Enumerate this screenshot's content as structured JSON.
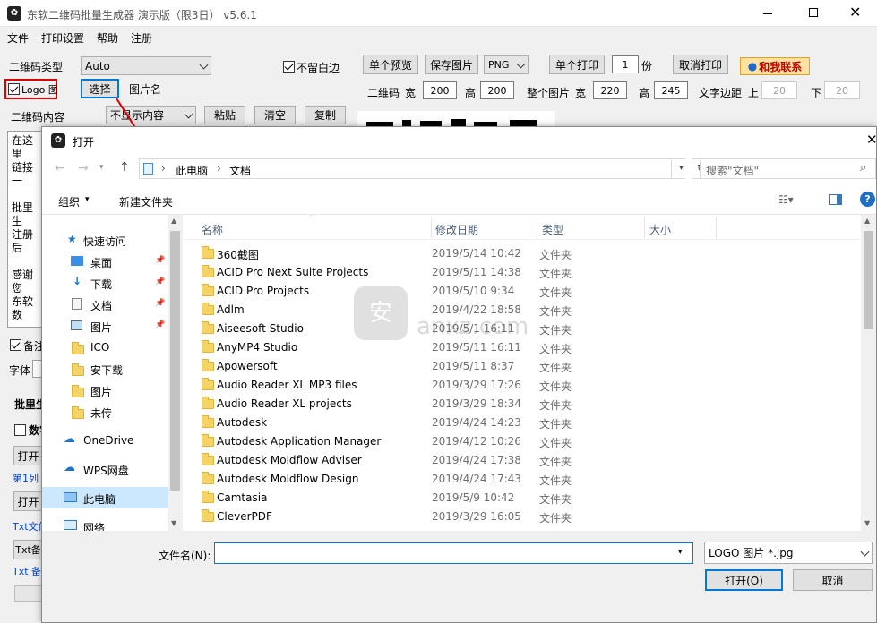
{
  "app": {
    "title": "东软二维码批量生成器 演示版（限3日） v5.6.1"
  },
  "menu": [
    "文件",
    "打印设置",
    "帮助",
    "注册"
  ],
  "main": {
    "qr_type_label": "二维码类型",
    "qr_type_value": "Auto",
    "no_margin_label": "不留白边",
    "logo_label": "Logo 图",
    "select_button": "选择",
    "image_name_label": "图片名",
    "content_label": "二维码内容",
    "content_option": "不显示内容",
    "paste_button": "粘贴",
    "clear_button": "清空",
    "copy_button": "复制",
    "preview_button": "单个预览",
    "save_image_button": "保存图片",
    "format_value": "PNG",
    "print_button": "单个打印",
    "copies_value": "1",
    "copies_unit": "份",
    "cancel_print_button": "取消打印",
    "contact_button": "和我联系",
    "qr_label": "二维码",
    "width_label": "宽",
    "width_value": "200",
    "height_label": "高",
    "height_value": "200",
    "whole_label": "整个图片",
    "whole_width_label": "宽",
    "whole_width_value": "220",
    "whole_height_label": "高",
    "whole_height_value": "245",
    "text_margin_label": "文字边距",
    "top_label": "上",
    "top_value": "20",
    "bottom_label": "下",
    "bottom_value": "20",
    "textarea_lines": [
      "在这里",
      "链接一",
      "",
      "批里生",
      "注册后",
      "",
      "感谢您",
      "东软数"
    ],
    "backup_label": "备注",
    "font_label": "字体",
    "batch_label": "批里生",
    "number_label": "数字",
    "open_button_1": "打开",
    "col1_label": "第1列",
    "open_button_2": "打开",
    "txt_label_1": "Txt文件",
    "txt_backup_button": "Txt备",
    "txt_label_2": "Txt 备"
  },
  "dialog": {
    "title": "打开",
    "breadcrumb": [
      "此电脑",
      "文档"
    ],
    "search_placeholder": "搜索\"文档\"",
    "organize_label": "组织",
    "new_folder_label": "新建文件夹",
    "columns": {
      "name": "名称",
      "date": "修改日期",
      "type": "类型",
      "size": "大小"
    },
    "nav": [
      {
        "label": "快速访问",
        "icon": "star-icon"
      },
      {
        "label": "桌面",
        "icon": "desktop-icon",
        "pinned": true
      },
      {
        "label": "下载",
        "icon": "download-icon",
        "pinned": true
      },
      {
        "label": "文档",
        "icon": "document-icon",
        "pinned": true
      },
      {
        "label": "图片",
        "icon": "picture-icon",
        "pinned": true
      },
      {
        "label": "ICO",
        "icon": "folder-icon"
      },
      {
        "label": "安下载",
        "icon": "folder-icon"
      },
      {
        "label": "图片",
        "icon": "folder-icon"
      },
      {
        "label": "未传",
        "icon": "folder-icon"
      },
      {
        "label": "OneDrive",
        "icon": "cloud-icon"
      },
      {
        "label": "WPS网盘",
        "icon": "cloud-icon"
      },
      {
        "label": "此电脑",
        "icon": "computer-icon"
      },
      {
        "label": "网络",
        "icon": "network-icon"
      }
    ],
    "files": [
      {
        "name": "360截图",
        "date": "2019/5/14 10:42",
        "type": "文件夹"
      },
      {
        "name": "ACID Pro Next Suite Projects",
        "date": "2019/5/11 14:38",
        "type": "文件夹"
      },
      {
        "name": "ACID Pro Projects",
        "date": "2019/5/10 9:34",
        "type": "文件夹"
      },
      {
        "name": "Adlm",
        "date": "2019/4/22 18:58",
        "type": "文件夹"
      },
      {
        "name": "Aiseesoft Studio",
        "date": "2019/5/1 16:11",
        "type": "文件夹"
      },
      {
        "name": "AnyMP4 Studio",
        "date": "2019/5/11 16:11",
        "type": "文件夹"
      },
      {
        "name": "Apowersoft",
        "date": "2019/5/11 8:37",
        "type": "文件夹"
      },
      {
        "name": "Audio Reader XL MP3 files",
        "date": "2019/3/29 17:26",
        "type": "文件夹"
      },
      {
        "name": "Audio Reader XL projects",
        "date": "2019/3/29 18:34",
        "type": "文件夹"
      },
      {
        "name": "Autodesk",
        "date": "2019/4/24 14:23",
        "type": "文件夹"
      },
      {
        "name": "Autodesk Application Manager",
        "date": "2019/4/12 10:26",
        "type": "文件夹"
      },
      {
        "name": "Autodesk Moldflow Adviser",
        "date": "2019/4/24 17:38",
        "type": "文件夹"
      },
      {
        "name": "Autodesk Moldflow Design",
        "date": "2019/4/24 17:43",
        "type": "文件夹"
      },
      {
        "name": "Camtasia",
        "date": "2019/5/9 10:42",
        "type": "文件夹"
      },
      {
        "name": "CleverPDF",
        "date": "2019/3/29 16:05",
        "type": "文件夹"
      }
    ],
    "filename_label": "文件名(N):",
    "filename_value": "",
    "filter_value": "LOGO 图片 *.jpg",
    "open_button": "打开(O)",
    "cancel_button": "取消",
    "watermark": "anxz.com"
  }
}
